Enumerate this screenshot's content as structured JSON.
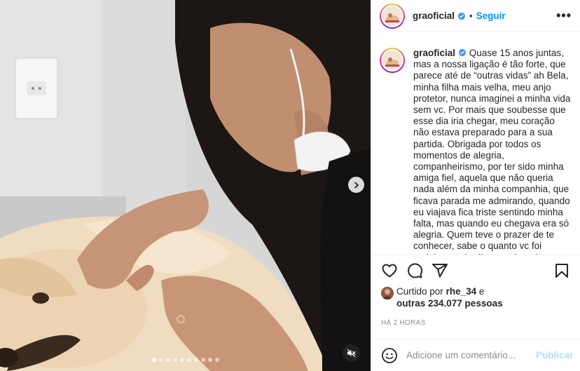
{
  "colors": {
    "accent": "#0095f6",
    "publish_disabled": "#b2dffc",
    "muted_text": "#8e8e8e",
    "border": "#efefef"
  },
  "media": {
    "next_icon": "chevron-right-icon",
    "mute_icon": "speaker-muted-icon",
    "carousel_dots": 10,
    "active_dot": 0
  },
  "header": {
    "username": "graoficial",
    "verified_icon": "verified-badge-icon",
    "separator": "•",
    "follow_label": "Seguir",
    "more_icon": "more-options-icon",
    "more_label": "•••"
  },
  "caption": {
    "username": "graoficial",
    "text": "Quase 15 anos juntas, mas a nossa ligação é tão forte, que parece até de “outras vidas” ah Bela, minha filha mais velha, meu anjo protetor, nunca imaginei a minha vida sem vc. Por mais que soubesse que esse dia iria chegar, meu coração não estava preparado para a sua partida. Obrigada por todos os momentos de alegria, companheirismo, por ter sido minha amiga fiel, aquela que não queria nada além da minha companhia, que ficava parada me admirando, quando eu viajava fica triste sentindo minha falta, mas quando eu chegava era só alegria. Quem teve o prazer de te conhecer, sabe o quanto vc foi carinhosa, obediente, educada, amorosa e feliz!"
  },
  "actions": {
    "like_icon": "heart-icon",
    "comment_icon": "comment-icon",
    "share_icon": "share-icon",
    "save_icon": "bookmark-icon"
  },
  "likes": {
    "prefix": "Curtido por",
    "liker": "rhe_34",
    "connector": "e",
    "others": "outras 234.077 pessoas"
  },
  "timestamp": "HÁ 2 HORAS",
  "comment": {
    "emoji_icon": "emoji-icon",
    "placeholder": "Adicione um comentário...",
    "publish_label": "Publicar"
  }
}
